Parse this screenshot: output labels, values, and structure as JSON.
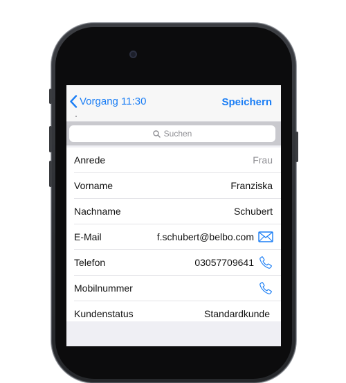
{
  "nav": {
    "back_label": "Vorgang 11:30",
    "save_label": "Speichern"
  },
  "search": {
    "placeholder": "Suchen"
  },
  "fields": [
    {
      "label": "Anrede",
      "value": "Frau"
    },
    {
      "label": "Vorname",
      "value": "Franziska"
    },
    {
      "label": "Nachname",
      "value": "Schubert"
    },
    {
      "label": "E-Mail",
      "value": "f.schubert@belbo.com",
      "action_icon": "mail-icon"
    },
    {
      "label": "Telefon",
      "value": "03057709641",
      "action_icon": "phone-icon"
    },
    {
      "label": "Mobilnummer",
      "value": "",
      "action_icon": "phone-icon"
    },
    {
      "label": "Kundenstatus",
      "value": "Standardkunde"
    }
  ],
  "colors": {
    "accent": "#1b7ef5",
    "placeholder": "#8e8e93",
    "device_body": "#2e3034"
  }
}
